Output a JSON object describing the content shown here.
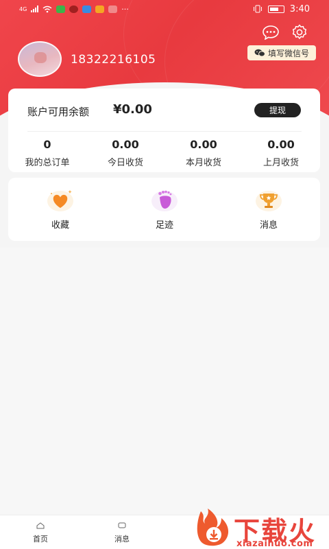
{
  "status_bar": {
    "network": "4G",
    "time": "3:40"
  },
  "profile": {
    "phone": "18322216105"
  },
  "header_actions": {
    "wechat_label": "填写微信号"
  },
  "balance": {
    "label": "账户可用余额",
    "amount": "¥0.00",
    "withdraw_label": "提现"
  },
  "stats": [
    {
      "value": "0",
      "label": "我的总订单"
    },
    {
      "value": "0.00",
      "label": "今日收货"
    },
    {
      "value": "0.00",
      "label": "本月收货"
    },
    {
      "value": "0.00",
      "label": "上月收货"
    }
  ],
  "features": [
    {
      "label": "收藏",
      "icon": "heart-icon"
    },
    {
      "label": "足迹",
      "icon": "footprint-icon"
    },
    {
      "label": "消息",
      "icon": "trophy-icon"
    }
  ],
  "tabbar": [
    {
      "label": "首页"
    },
    {
      "label": "消息"
    }
  ],
  "watermark": {
    "big": "下载火",
    "small": "xiazaihuo.com"
  },
  "colors": {
    "brand_red": "#e83a3f",
    "dark_button": "#222222",
    "pill_bg": "#fdf1da",
    "watermark_red": "#e8453c"
  }
}
